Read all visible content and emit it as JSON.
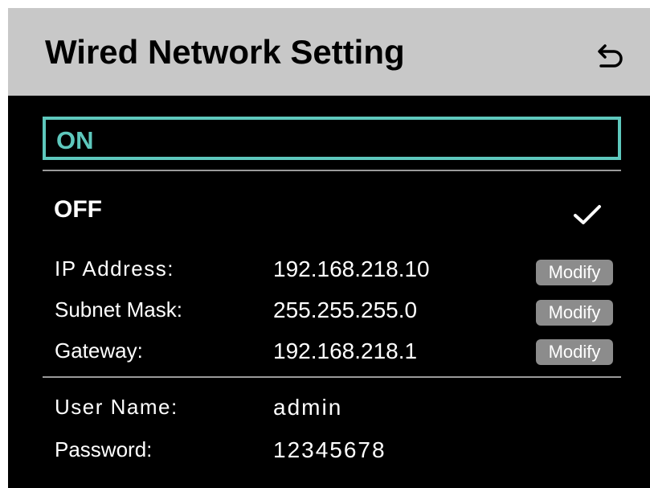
{
  "header": {
    "title": "Wired Network Setting"
  },
  "options": {
    "on_label": "ON",
    "off_label": "OFF",
    "selected": "OFF"
  },
  "network": {
    "ip_label": "IP Address:",
    "ip_value": "192.168.218.10",
    "subnet_label": "Subnet Mask:",
    "subnet_value": "255.255.255.0",
    "gateway_label": "Gateway:",
    "gateway_value": "192.168.218.1",
    "modify_label": "Modify"
  },
  "account": {
    "username_label": "User Name:",
    "username_value": "admin",
    "password_label": "Password:",
    "password_value": "12345678"
  },
  "icons": {
    "back": "back-arrow-icon",
    "check": "checkmark-icon"
  },
  "colors": {
    "header_bg": "#c8c8c8",
    "screen_bg": "#000000",
    "accent": "#5ec8bd",
    "button_bg": "#8c8c8c"
  }
}
